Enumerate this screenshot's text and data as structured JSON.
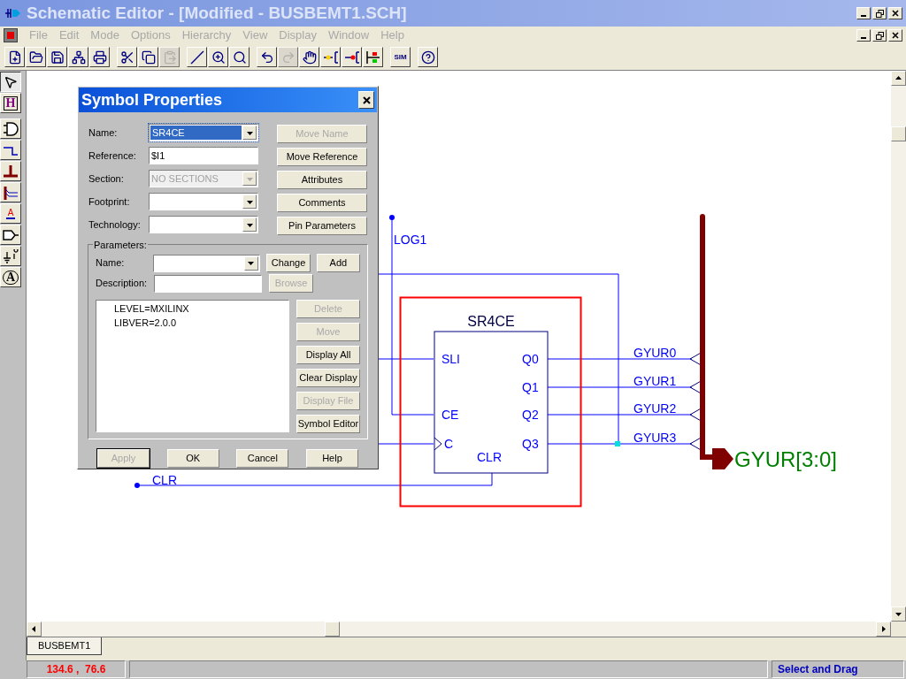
{
  "window": {
    "title": "Schematic Editor - [Modified - BUSBEMT1.SCH]"
  },
  "menu": [
    "File",
    "Edit",
    "Mode",
    "Options",
    "Hierarchy",
    "View",
    "Display",
    "Window",
    "Help"
  ],
  "toolbar": [
    {
      "kind": "new",
      "disabled": false
    },
    {
      "kind": "open",
      "disabled": false
    },
    {
      "kind": "save",
      "disabled": false
    },
    {
      "kind": "hierarchy",
      "disabled": false
    },
    {
      "kind": "print",
      "disabled": false
    },
    {
      "kind": "cut",
      "disabled": false
    },
    {
      "kind": "copy",
      "disabled": false
    },
    {
      "kind": "paste",
      "disabled": true
    },
    {
      "kind": "wire",
      "disabled": false
    },
    {
      "kind": "zoom",
      "disabled": false
    },
    {
      "kind": "zoomfit",
      "disabled": false
    },
    {
      "kind": "undo",
      "disabled": false
    },
    {
      "kind": "redo",
      "disabled": true
    },
    {
      "kind": "pointer",
      "disabled": false
    },
    {
      "kind": "pinin",
      "disabled": false
    },
    {
      "kind": "pinout",
      "disabled": false
    },
    {
      "kind": "probe",
      "disabled": false
    },
    {
      "kind": "sim",
      "disabled": false,
      "label": "SIM"
    },
    {
      "kind": "help",
      "disabled": false
    }
  ],
  "tools": [
    {
      "kind": "select",
      "selected": true
    },
    {
      "kind": "hier",
      "selected": false,
      "label": "H"
    },
    {
      "kind": "gate",
      "selected": false
    },
    {
      "kind": "wire",
      "selected": false
    },
    {
      "kind": "bus",
      "selected": false
    },
    {
      "kind": "tap",
      "selected": false
    },
    {
      "kind": "label",
      "selected": false,
      "label": "A"
    },
    {
      "kind": "port",
      "selected": false
    },
    {
      "kind": "power",
      "selected": false
    },
    {
      "kind": "text",
      "selected": false,
      "label": "A"
    }
  ],
  "dialog": {
    "title": "Symbol Properties",
    "fields": [
      {
        "label": "Name:",
        "value": "SR4CE",
        "kind": "dropdown",
        "disabled": false,
        "highlighted": true
      },
      {
        "label": "Reference:",
        "value": "$I1",
        "kind": "text",
        "disabled": false,
        "highlighted": false
      },
      {
        "label": "Section:",
        "value": "NO SECTIONS",
        "kind": "dropdown",
        "disabled": true,
        "highlighted": false
      },
      {
        "label": "Footprint:",
        "kind": "dropdown",
        "disabled": false,
        "highlighted": false
      },
      {
        "label": "Technology:",
        "kind": "dropdown",
        "disabled": false,
        "highlighted": false
      }
    ],
    "side_buttons": [
      {
        "label": "Move Name",
        "disabled": true
      },
      {
        "label": "Move Reference",
        "disabled": false
      },
      {
        "label": "Attributes",
        "disabled": false
      },
      {
        "label": "Comments",
        "disabled": false
      },
      {
        "label": "Pin Parameters",
        "disabled": false
      }
    ],
    "parameters": {
      "title": "Parameters:",
      "name_label": "Name:",
      "description_label": "Description:",
      "name_buttons": [
        {
          "label": "Change",
          "disabled": false
        },
        {
          "label": "Add",
          "disabled": false
        }
      ],
      "browse": {
        "label": "Browse",
        "disabled": true
      },
      "list": [
        "LEVEL=MXILINX",
        "LIBVER=2.0.0"
      ],
      "list_buttons": [
        {
          "label": "Delete",
          "disabled": true
        },
        {
          "label": "Move",
          "disabled": true
        },
        {
          "label": "Display All",
          "disabled": false
        },
        {
          "label": "Clear Display",
          "disabled": false
        },
        {
          "label": "Display File",
          "disabled": true
        },
        {
          "label": "Symbol Editor",
          "disabled": false
        }
      ]
    },
    "buttons": [
      {
        "label": "Apply",
        "disabled": true,
        "focused": true
      },
      {
        "label": "OK",
        "disabled": false,
        "focused": false
      },
      {
        "label": "Cancel",
        "disabled": false,
        "focused": false
      },
      {
        "label": "Help",
        "disabled": false,
        "focused": false
      }
    ]
  },
  "schematic": {
    "symbol": {
      "name": "SR4CE",
      "selected": true,
      "inputs": [
        "SLI",
        "CE",
        "C"
      ],
      "outputs": [
        "Q0",
        "Q1",
        "Q2",
        "Q3"
      ],
      "bottom": "CLR"
    },
    "nets": [
      "LOG1",
      "CLR"
    ],
    "bus_taps": [
      "GYUR0",
      "GYUR1",
      "GYUR2",
      "GYUR3"
    ],
    "bus_label": "GYUR[3:0]"
  },
  "tabs": [
    {
      "label": "BUSBEMT1",
      "selected": true
    }
  ],
  "status_bar": {
    "coordinates": "134.6 ,  76.6",
    "mode": "Select and Drag"
  }
}
